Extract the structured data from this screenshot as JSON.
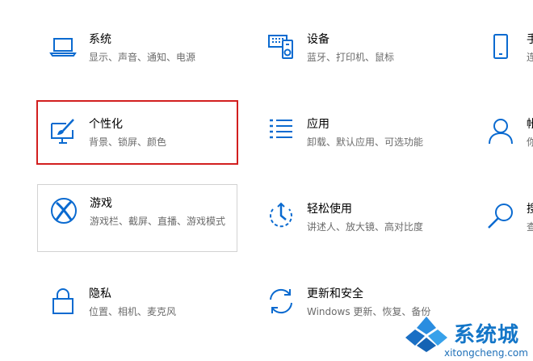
{
  "colors": {
    "icon": "#0a6ad0",
    "title": "#000000",
    "description": "#6b6b6b",
    "highlight_border": "#d21f1f",
    "hover_border": "#d2d2d2"
  },
  "tiles": [
    {
      "title": "系统",
      "description": "显示、声音、通知、电源",
      "icon": "laptop-icon"
    },
    {
      "title": "设备",
      "description": "蓝牙、打印机、鼠标",
      "icon": "devices-icon"
    },
    {
      "title": "手",
      "description": "连",
      "icon": "phone-icon"
    },
    {
      "title": "个性化",
      "description": "背景、锁屏、颜色",
      "icon": "personalization-icon"
    },
    {
      "title": "应用",
      "description": "卸载、默认应用、可选功能",
      "icon": "apps-list-icon"
    },
    {
      "title": "帐",
      "description": "你",
      "icon": "account-icon"
    },
    {
      "title": "游戏",
      "description": "游戏栏、截屏、直播、游戏模式",
      "icon": "xbox-icon"
    },
    {
      "title": "轻松使用",
      "description": "讲述人、放大镜、高对比度",
      "icon": "ease-of-access-icon"
    },
    {
      "title": "搜",
      "description": "查",
      "icon": "search-icon"
    },
    {
      "title": "隐私",
      "description": "位置、相机、麦克风",
      "icon": "lock-icon"
    },
    {
      "title": "更新和安全",
      "description": "Windows 更新、恢复、备份",
      "icon": "update-sync-icon"
    }
  ],
  "watermark": {
    "name": "系统城",
    "url": "xitongcheng.com"
  }
}
